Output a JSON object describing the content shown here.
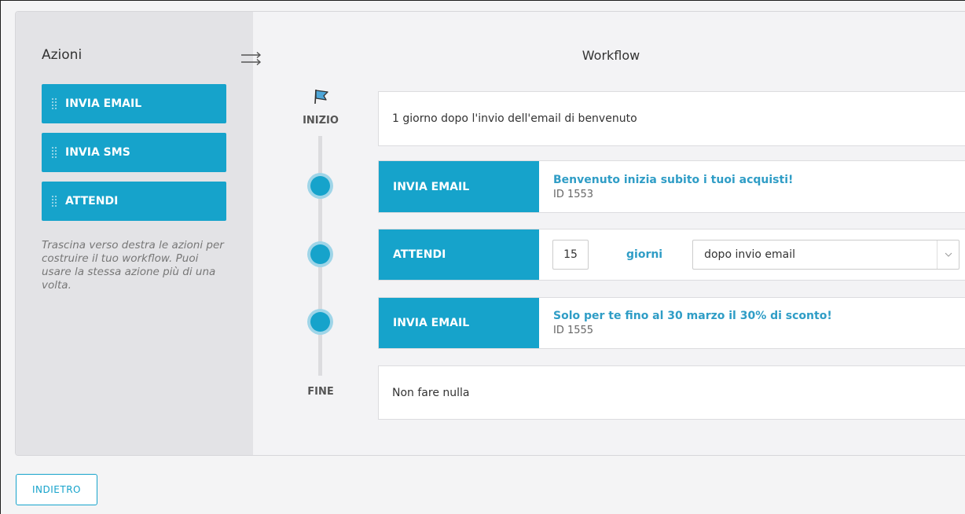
{
  "sidebar": {
    "title": "Azioni",
    "actions": [
      {
        "label": "INVIA EMAIL"
      },
      {
        "label": "INVIA SMS"
      },
      {
        "label": "ATTENDI"
      }
    ],
    "hint": "Trascina verso destra le azioni per costruire il tuo workflow. Puoi usare la stessa azione più di una volta."
  },
  "workflow": {
    "title": "Workflow",
    "start_label": "INIZIO",
    "end_label": "FINE",
    "trigger": "1 giorno dopo l'invio dell'email di benvenuto",
    "steps": [
      {
        "tag": "INVIA EMAIL",
        "email_title": "Benvenuto inizia subito i tuoi acquisti!",
        "email_id": "ID 1553"
      },
      {
        "tag": "ATTENDI",
        "quantity": "15",
        "unit": "giorni",
        "condition": "dopo invio email"
      },
      {
        "tag": "INVIA EMAIL",
        "email_title": "Solo per te fino al 30 marzo il 30% di sconto!",
        "email_id": "ID 1555"
      }
    ],
    "end_action": "Non fare nulla"
  },
  "footer": {
    "back_label": "INDIETRO"
  },
  "colors": {
    "accent": "#16a3cb",
    "accent_light": "#9fd5e8",
    "sidebar_bg": "#e3e3e6"
  }
}
